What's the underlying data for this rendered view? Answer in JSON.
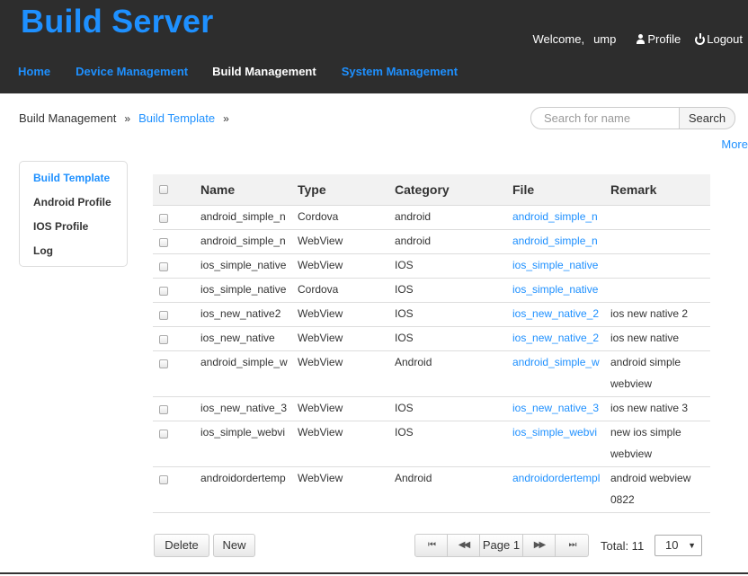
{
  "app": {
    "title": "Build Server"
  },
  "user": {
    "welcome": "Welcome,",
    "name": "ump",
    "profile": "Profile",
    "logout": "Logout"
  },
  "nav": [
    {
      "label": "Home",
      "active": false
    },
    {
      "label": "Device Management",
      "active": false
    },
    {
      "label": "Build Management",
      "active": true
    },
    {
      "label": "System Management",
      "active": false
    }
  ],
  "breadcrumb": {
    "root": "Build Management",
    "sep": "»",
    "current": "Build Template"
  },
  "search": {
    "placeholder": "Search for name",
    "button": "Search",
    "more": "More"
  },
  "sidebar": [
    {
      "label": "Build Template",
      "active": true
    },
    {
      "label": "Android Profile",
      "active": false
    },
    {
      "label": "IOS Profile",
      "active": false
    },
    {
      "label": "Log",
      "active": false
    }
  ],
  "table": {
    "headers": [
      "Name",
      "Type",
      "Category",
      "File",
      "Remark"
    ],
    "rows": [
      {
        "name": "android_simple_n",
        "type": "Cordova",
        "category": "android",
        "file": "android_simple_n",
        "remark": ""
      },
      {
        "name": "android_simple_n",
        "type": "WebView",
        "category": "android",
        "file": "android_simple_n",
        "remark": ""
      },
      {
        "name": "ios_simple_native",
        "type": "WebView",
        "category": "IOS",
        "file": "ios_simple_native",
        "remark": ""
      },
      {
        "name": "ios_simple_native",
        "type": "Cordova",
        "category": "IOS",
        "file": "ios_simple_native",
        "remark": ""
      },
      {
        "name": "ios_new_native2",
        "type": "WebView",
        "category": "IOS",
        "file": "ios_new_native_2",
        "remark": "ios new native 2"
      },
      {
        "name": "ios_new_native",
        "type": "WebView",
        "category": "IOS",
        "file": "ios_new_native_2",
        "remark": "ios new native"
      },
      {
        "name": "android_simple_w",
        "type": "WebView",
        "category": "Android",
        "file": "android_simple_w",
        "remark": "android simple webview"
      },
      {
        "name": "ios_new_native_3",
        "type": "WebView",
        "category": "IOS",
        "file": "ios_new_native_3",
        "remark": "ios new native 3"
      },
      {
        "name": "ios_simple_webvi",
        "type": "WebView",
        "category": "IOS",
        "file": "ios_simple_webvi",
        "remark": "new ios simple webview"
      },
      {
        "name": "androidordertemp",
        "type": "WebView",
        "category": "Android",
        "file": "androidordertempl",
        "remark": "android webview 0822"
      }
    ]
  },
  "actions": {
    "delete": "Delete",
    "new": "New"
  },
  "pager": {
    "first": "⏮",
    "prev": "◀◀",
    "page": "Page 1",
    "next": "▶▶",
    "last": "⏭",
    "total": "Total: 11",
    "page_size": "10"
  }
}
